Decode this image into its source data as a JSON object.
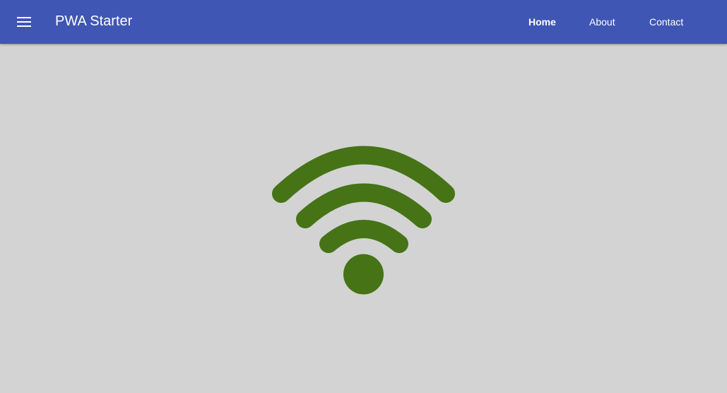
{
  "header": {
    "title": "PWA Starter",
    "menu_icon": "hamburger-menu-icon"
  },
  "nav": {
    "items": [
      {
        "label": "Home",
        "active": true
      },
      {
        "label": "About",
        "active": false
      },
      {
        "label": "Contact",
        "active": false
      }
    ]
  },
  "main": {
    "icon": "wifi-icon",
    "icon_color": "#457316"
  },
  "colors": {
    "app_bar": "#3f56b5",
    "background": "#d3d3d3",
    "header_text": "#ffffff"
  }
}
